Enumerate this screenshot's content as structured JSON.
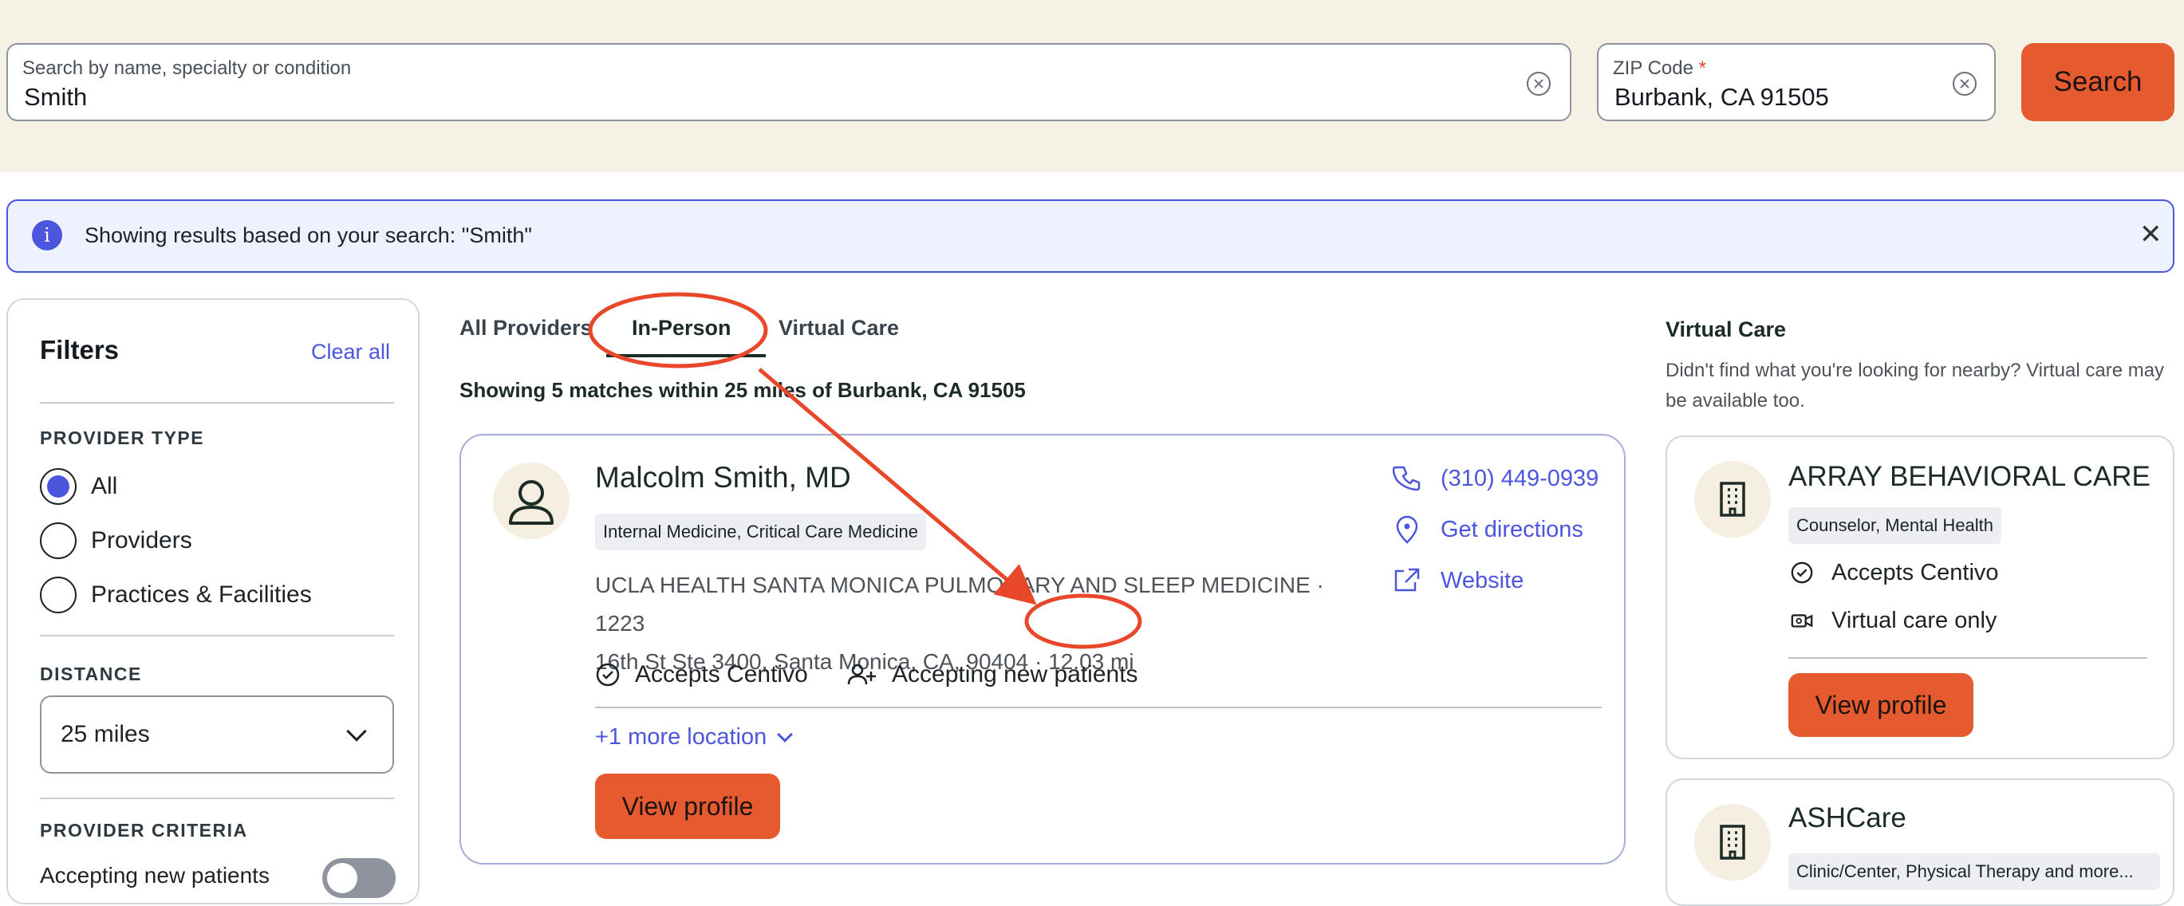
{
  "search": {
    "query_label": "Search by name, specialty or condition",
    "query_value": "Smith",
    "zip_label": "ZIP Code",
    "zip_required_mark": "*",
    "zip_value": "Burbank, CA 91505",
    "button_label": "Search"
  },
  "banner": {
    "info_glyph": "i",
    "text": "Showing results based on your search: \"Smith\"",
    "close_glyph": "✕"
  },
  "filters": {
    "title": "Filters",
    "clear_all": "Clear all",
    "provider_type_title": "PROVIDER TYPE",
    "provider_types": [
      {
        "label": "All",
        "selected": true
      },
      {
        "label": "Providers",
        "selected": false
      },
      {
        "label": "Practices & Facilities",
        "selected": false
      }
    ],
    "distance_title": "DISTANCE",
    "distance_value": "25 miles",
    "criteria_title": "PROVIDER CRITERIA",
    "accepting_label": "Accepting new patients"
  },
  "tabs": [
    {
      "label": "All Providers",
      "active": false
    },
    {
      "label": "In-Person",
      "active": true
    },
    {
      "label": "Virtual Care",
      "active": false
    }
  ],
  "summary": "Showing 5 matches within 25 miles of Burbank, CA 91505",
  "provider": {
    "name": "Malcolm Smith, MD",
    "specialty": "Internal Medicine, Critical Care Medicine",
    "address_line1": "UCLA HEALTH SANTA MONICA PULMONARY AND SLEEP MEDICINE · 1223",
    "address_line2": "16th St Ste 3400, Santa Monica, CA, 90404 ·",
    "distance": "12.03 mi",
    "accepts": "Accepts Centivo",
    "accepting_new": "Accepting new patients",
    "more_locations": "+1 more location",
    "phone": "(310) 449-0939",
    "directions": "Get directions",
    "website": "Website",
    "view_profile": "View profile"
  },
  "virtual_care": {
    "title": "Virtual Care",
    "description": "Didn't find what you're looking for nearby? Virtual care may be available too.",
    "cards": [
      {
        "name": "ARRAY BEHAVIORAL CARE",
        "tag": "Counselor, Mental Health",
        "accepts": "Accepts Centivo",
        "mode": "Virtual care only",
        "view_profile": "View profile"
      },
      {
        "name": "ASHCare",
        "tag": "Clinic/Center, Physical Therapy and more..."
      }
    ]
  },
  "colors": {
    "accent": "#4c55de",
    "button": "#e55a2e",
    "annotation": "#e8472a",
    "header_bg": "#f5f1e4"
  }
}
